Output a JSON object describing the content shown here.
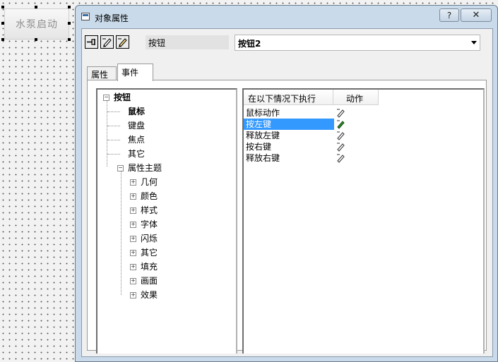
{
  "canvas": {
    "button_label": "水泵启动"
  },
  "window": {
    "title": "对象属性",
    "help_label": "?",
    "close_label": "✕"
  },
  "toolbar": {
    "icons": [
      "pin-icon",
      "edit-pencil-icon",
      "edit-pencil-icon"
    ],
    "object_type": "按钮",
    "object_name": "按钮2"
  },
  "tabs": {
    "properties": "属性",
    "events": "事件",
    "active": "events"
  },
  "tree": {
    "root": "按钮",
    "mouse": "鼠标",
    "keyboard": "键盘",
    "focus": "焦点",
    "other": "其它",
    "property_themes": "属性主题",
    "themes": [
      "几何",
      "颜色",
      "样式",
      "字体",
      "闪烁",
      "其它",
      "填充",
      "画面",
      "效果"
    ]
  },
  "events": {
    "col_condition": "在以下情况下执行",
    "col_action": "动作",
    "rows": [
      "鼠标动作",
      "按左键",
      "释放左键",
      "按右键",
      "释放右键"
    ],
    "selected_index": 1,
    "configured_index": 1,
    "selection_color": "#3399ff"
  }
}
